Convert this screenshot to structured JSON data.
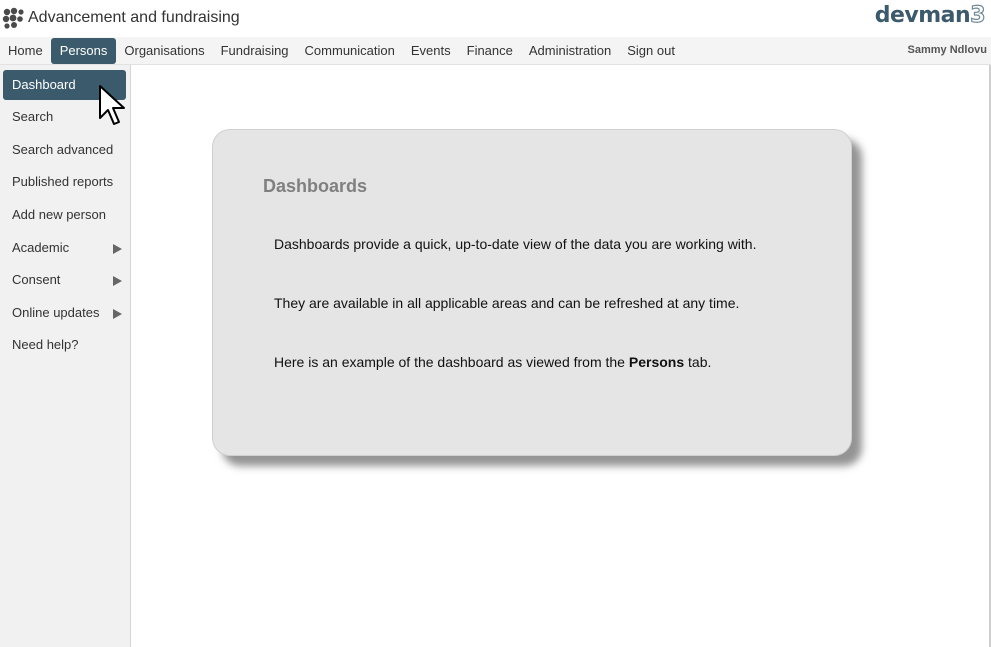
{
  "header": {
    "app_title": "Advancement and fundraising",
    "brand": "devman",
    "brand_version": "3"
  },
  "nav": {
    "items": [
      "Home",
      "Persons",
      "Organisations",
      "Fundraising",
      "Communication",
      "Events",
      "Finance",
      "Administration",
      "Sign out"
    ],
    "active": "Persons",
    "user": "Sammy Ndlovu"
  },
  "sidebar": {
    "items": [
      {
        "label": "Dashboard"
      },
      {
        "label": "Search"
      },
      {
        "label": "Search advanced"
      },
      {
        "label": "Published reports"
      },
      {
        "label": "Add new person"
      },
      {
        "label": "Academic"
      },
      {
        "label": "Consent"
      },
      {
        "label": "Online updates"
      },
      {
        "label": "Need help?"
      }
    ],
    "active": "Dashboard"
  },
  "panel": {
    "title": "Dashboards",
    "line1": "Dashboards provide a quick, up-to-date view of the data you are working with.",
    "line2": "They are available in all applicable areas and can be refreshed at any time.",
    "line3_before": "Here is an example of the dashboard as viewed from the ",
    "line3_bold": "Persons",
    "line3_after": " tab."
  },
  "colors": {
    "accent": "#3b5b6c",
    "brand": "#3d5a6c",
    "panel_bg": "#e5e5e5"
  },
  "icons": {
    "app_logo": "dots-logo-icon",
    "submenu_arrow": "triangle-right-icon",
    "cursor": "mouse-pointer-icon"
  }
}
